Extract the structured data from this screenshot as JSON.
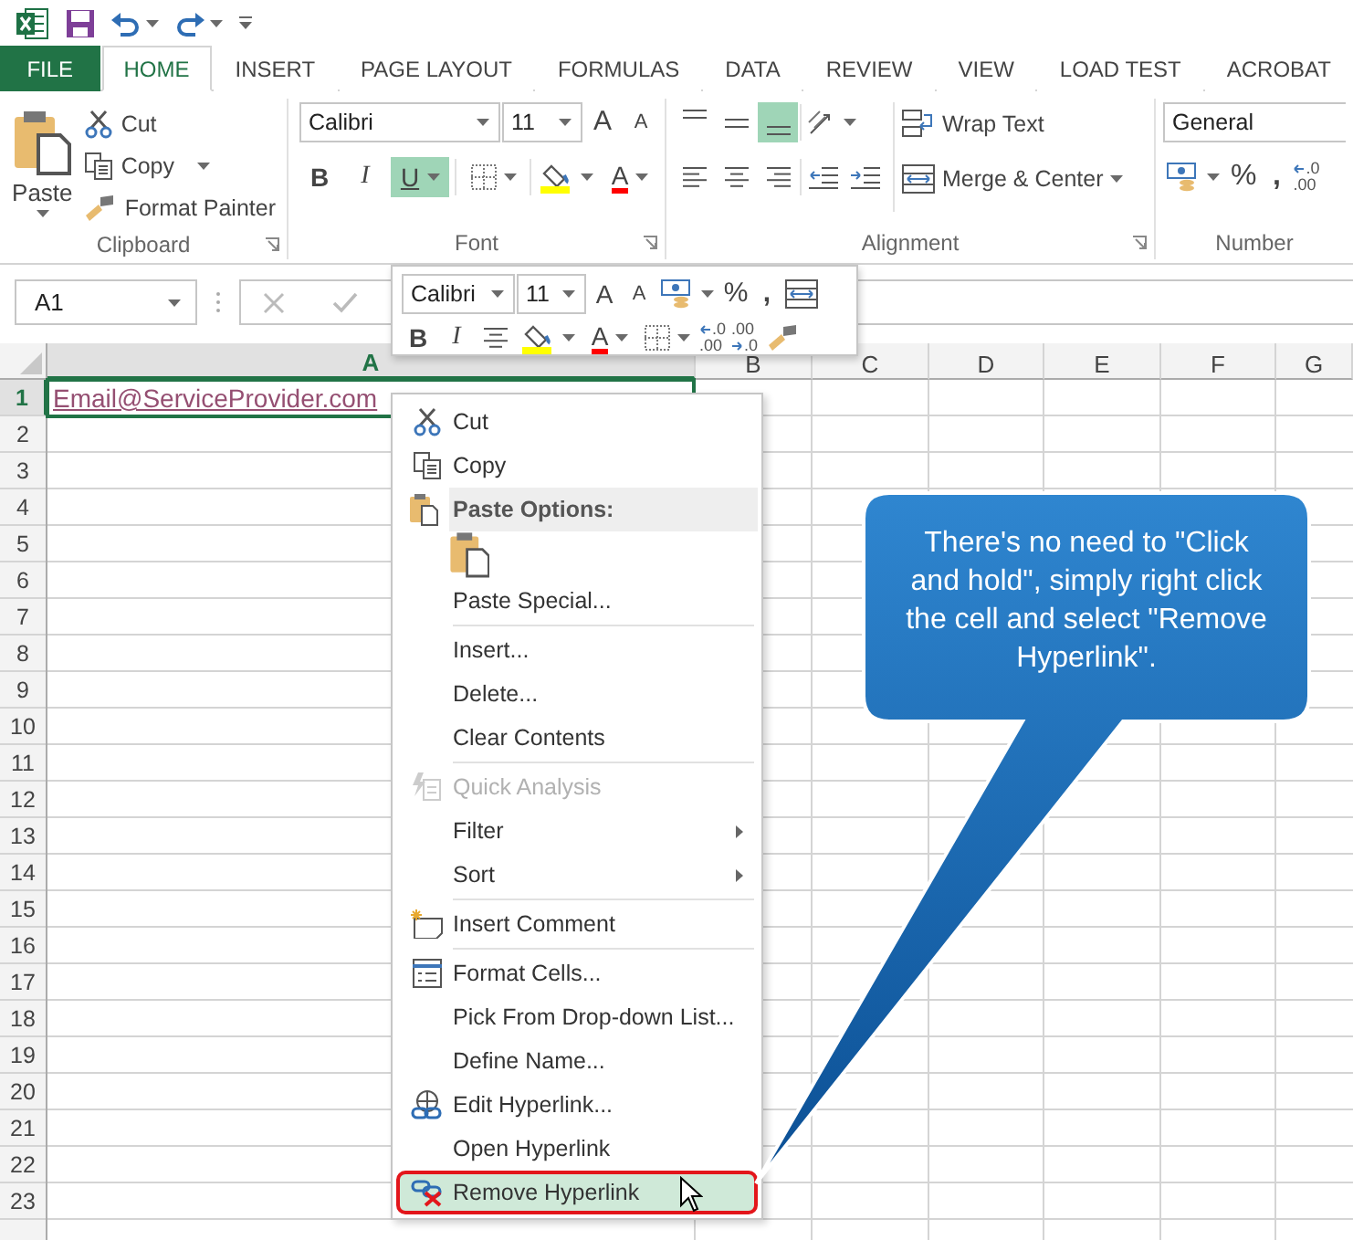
{
  "tabs": [
    {
      "label": "FILE",
      "kind": "file",
      "selected": false
    },
    {
      "label": "HOME",
      "kind": "tab",
      "selected": true
    },
    {
      "label": "INSERT",
      "kind": "tab",
      "selected": false
    },
    {
      "label": "PAGE LAYOUT",
      "kind": "tab",
      "selected": false
    },
    {
      "label": "FORMULAS",
      "kind": "tab",
      "selected": false
    },
    {
      "label": "DATA",
      "kind": "tab",
      "selected": false
    },
    {
      "label": "REVIEW",
      "kind": "tab",
      "selected": false
    },
    {
      "label": "VIEW",
      "kind": "tab",
      "selected": false
    },
    {
      "label": "LOAD TEST",
      "kind": "tab",
      "selected": false
    },
    {
      "label": "ACROBAT",
      "kind": "tab",
      "selected": false
    }
  ],
  "ribbon": {
    "clipboard": {
      "label": "Clipboard",
      "paste": "Paste",
      "cut": "Cut",
      "copy": "Copy",
      "format_painter": "Format Painter"
    },
    "font": {
      "label": "Font",
      "font_name": "Calibri",
      "font_size": "11",
      "grow": "A",
      "shrink": "A",
      "bold": "B",
      "italic": "I",
      "underline": {
        "text": "U",
        "on": true
      },
      "font_color": "A"
    },
    "alignment": {
      "label": "Alignment",
      "vertical_align": [
        {
          "selected": false
        },
        {
          "selected": false
        },
        {
          "selected": true
        }
      ],
      "wrap_text": "Wrap Text",
      "merge_center": "Merge & Center"
    },
    "number": {
      "label": "Number",
      "format": "General",
      "percent": "%",
      "comma": ",",
      "decimal": {
        "top": ".0",
        "bottom": ".00"
      }
    }
  },
  "formula_bar": {
    "name_box": "A1"
  },
  "mini_toolbar": {
    "font_name": "Calibri",
    "font_size": "11",
    "grow": "A",
    "shrink": "A",
    "percent": "%",
    "comma": ",",
    "bold": "B",
    "italic": "I",
    "font_color": "A",
    "increase_decimal": {
      "top": ".0",
      "bottom": ".00"
    },
    "decrease_decimal": {
      "top": ".00",
      "bottom": ".0"
    }
  },
  "sheet": {
    "columns": [
      {
        "label": "A",
        "selected": true
      },
      {
        "label": "B",
        "selected": false
      },
      {
        "label": "C",
        "selected": false
      },
      {
        "label": "D",
        "selected": false
      },
      {
        "label": "E",
        "selected": false
      },
      {
        "label": "F",
        "selected": false
      },
      {
        "label": "G",
        "selected": false
      }
    ],
    "rows": [
      {
        "label": "1",
        "selected": true,
        "cells": [
          {
            "value": "Email@ServiceProvider.com",
            "kind": "hyperlink"
          }
        ]
      },
      {
        "label": "2",
        "selected": false
      },
      {
        "label": "3",
        "selected": false
      },
      {
        "label": "4",
        "selected": false
      },
      {
        "label": "5",
        "selected": false
      },
      {
        "label": "6",
        "selected": false
      },
      {
        "label": "7",
        "selected": false
      },
      {
        "label": "8",
        "selected": false
      },
      {
        "label": "9",
        "selected": false
      },
      {
        "label": "10",
        "selected": false
      },
      {
        "label": "11",
        "selected": false
      },
      {
        "label": "12",
        "selected": false
      },
      {
        "label": "13",
        "selected": false
      },
      {
        "label": "14",
        "selected": false
      },
      {
        "label": "15",
        "selected": false
      },
      {
        "label": "16",
        "selected": false
      },
      {
        "label": "17",
        "selected": false
      },
      {
        "label": "18",
        "selected": false
      },
      {
        "label": "19",
        "selected": false
      },
      {
        "label": "20",
        "selected": false
      },
      {
        "label": "21",
        "selected": false
      },
      {
        "label": "22",
        "selected": false
      },
      {
        "label": "23",
        "selected": false
      }
    ]
  },
  "context_menu": [
    {
      "kind": "item",
      "label": "Cut",
      "disabled": false,
      "submenu": false,
      "selected": false
    },
    {
      "kind": "item",
      "label": "Copy",
      "disabled": false,
      "submenu": false,
      "selected": false
    },
    {
      "kind": "header",
      "label": "Paste Options:"
    },
    {
      "kind": "paste-option"
    },
    {
      "kind": "item",
      "label": "Paste Special...",
      "disabled": false,
      "submenu": false,
      "selected": false
    },
    {
      "kind": "separator"
    },
    {
      "kind": "item",
      "label": "Insert...",
      "disabled": false,
      "submenu": false,
      "selected": false
    },
    {
      "kind": "item",
      "label": "Delete...",
      "disabled": false,
      "submenu": false,
      "selected": false
    },
    {
      "kind": "item",
      "label": "Clear Contents",
      "disabled": false,
      "submenu": false,
      "selected": false
    },
    {
      "kind": "separator"
    },
    {
      "kind": "item",
      "label": "Quick Analysis",
      "disabled": true,
      "submenu": false,
      "selected": false
    },
    {
      "kind": "item",
      "label": "Filter",
      "disabled": false,
      "submenu": true,
      "selected": false
    },
    {
      "kind": "item",
      "label": "Sort",
      "disabled": false,
      "submenu": true,
      "selected": false
    },
    {
      "kind": "separator"
    },
    {
      "kind": "item",
      "label": "Insert Comment",
      "disabled": false,
      "submenu": false,
      "selected": false
    },
    {
      "kind": "separator"
    },
    {
      "kind": "item",
      "label": "Format Cells...",
      "disabled": false,
      "submenu": false,
      "selected": false
    },
    {
      "kind": "item",
      "label": "Pick From Drop-down List...",
      "disabled": false,
      "submenu": false,
      "selected": false
    },
    {
      "kind": "item",
      "label": "Define Name...",
      "disabled": false,
      "submenu": false,
      "selected": false
    },
    {
      "kind": "item",
      "label": "Edit Hyperlink...",
      "disabled": false,
      "submenu": false,
      "selected": false
    },
    {
      "kind": "item",
      "label": "Open Hyperlink",
      "disabled": false,
      "submenu": false,
      "selected": false
    },
    {
      "kind": "item",
      "label": "Remove Hyperlink",
      "disabled": false,
      "submenu": false,
      "selected": true
    }
  ],
  "callout": {
    "text": "There's no need to \"Click and hold\", simply right click the cell and select \"Remove Hyperlink\"."
  }
}
